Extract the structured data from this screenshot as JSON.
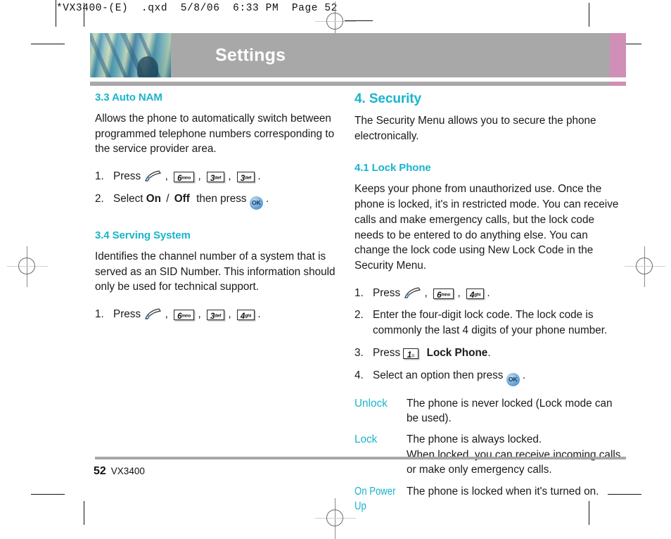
{
  "prepress": {
    "header_line": "*VX3400-(E)  .qxd  5/8/06  6:33 PM  Page 52"
  },
  "header": {
    "title": "Settings",
    "photo_alt": "abstract-architecture-photo",
    "band_color": "#a8a8a8",
    "accent_color": "#d08fb6"
  },
  "theme": {
    "heading_color": "#17b5cb",
    "body_color": "#1a1a1a"
  },
  "left_column": {
    "section_auto_nam": {
      "heading": "3.3 Auto NAM",
      "body": "Allows the phone to automatically switch between programmed telephone numbers corresponding to the service provider area.",
      "steps": [
        {
          "num": "1.",
          "verb": "Press",
          "keys": [
            "send",
            "6mno",
            "3def",
            "3def"
          ],
          "trailing": "."
        },
        {
          "num": "2.",
          "verb": "Select",
          "option_on": "On",
          "separator": "/",
          "option_off": "Off",
          "then": "then press",
          "keys": [
            "ok"
          ],
          "trailing": "."
        }
      ]
    },
    "section_serving_system": {
      "heading": "3.4 Serving System",
      "body": "Identifies the channel number of a system that is served as an SID Number. This information should only be used for technical support.",
      "steps": [
        {
          "num": "1.",
          "verb": "Press",
          "keys": [
            "send",
            "6mno",
            "3def",
            "4ghi"
          ],
          "trailing": "."
        }
      ]
    }
  },
  "right_column": {
    "section_security": {
      "heading": "4. Security",
      "body": "The Security Menu allows you to secure the phone electronically."
    },
    "section_lock_phone": {
      "heading": "4.1 Lock Phone",
      "body": "Keeps your phone from unauthorized use. Once the phone is locked, it's in restricted mode. You can receive calls and make emergency calls, but the lock code needs to be entered to do anything else. You can change the lock code using New Lock Code in the Security Menu.",
      "steps": [
        {
          "num": "1.",
          "verb": "Press",
          "keys": [
            "send",
            "6mno",
            "4ghi"
          ],
          "trailing": "."
        },
        {
          "num": "2.",
          "text": "Enter the four-digit lock code. The lock code is commonly the last 4 digits of your phone number."
        },
        {
          "num": "3.",
          "verb": "Press",
          "keys": [
            "1vm"
          ],
          "bold_label": "Lock Phone",
          "trailing": "."
        },
        {
          "num": "4.",
          "verb": "Select an option then press",
          "keys": [
            "ok"
          ],
          "trailing": "."
        }
      ],
      "options": [
        {
          "term": "Unlock",
          "desc": "The phone is never locked (Lock mode can be used)."
        },
        {
          "term": "Lock",
          "desc": "The phone is always locked.\nWhen locked, you can receive incoming calls or make only emergency calls."
        },
        {
          "term": "On Power Up",
          "desc": "The phone is locked when it's turned on."
        }
      ]
    }
  },
  "footer": {
    "page_number": "52",
    "model": "VX3400"
  },
  "keycaps": {
    "6mno": {
      "digit": "6",
      "sub": "mno"
    },
    "3def": {
      "digit": "3",
      "sub": "def"
    },
    "4ghi": {
      "digit": "4",
      "sub": "ghi"
    },
    "1vm": {
      "digit": "1",
      "sub": ""
    },
    "ok": {
      "label": "OK"
    }
  }
}
